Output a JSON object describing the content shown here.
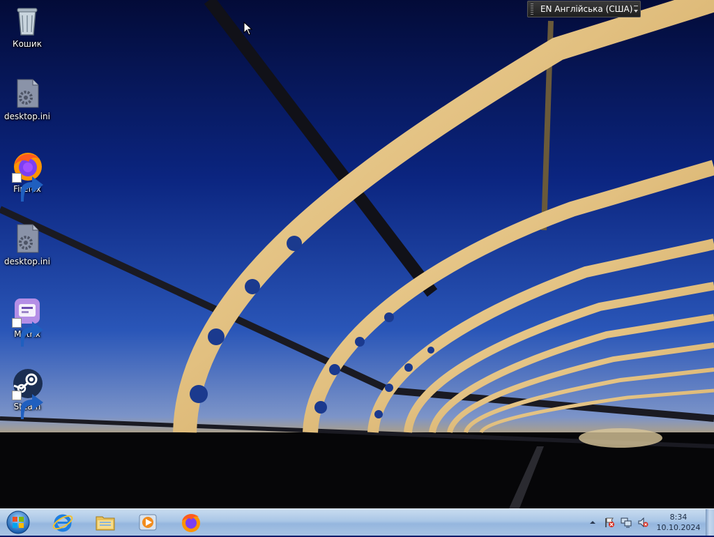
{
  "desktop": {
    "icons": [
      {
        "label": "Кошик",
        "icon": "recycle-bin-icon",
        "shortcut": false
      },
      {
        "label": "desktop.ini",
        "icon": "settings-file-icon",
        "shortcut": false
      },
      {
        "label": "Firefox",
        "icon": "firefox-icon",
        "shortcut": true
      },
      {
        "label": "desktop.ini",
        "icon": "settings-file-icon",
        "shortcut": false
      },
      {
        "label": "Motrix",
        "icon": "motrix-icon",
        "shortcut": true
      },
      {
        "label": "Steam",
        "icon": "steam-icon",
        "shortcut": true
      }
    ]
  },
  "language_bar": {
    "text": "EN Англійська (США)"
  },
  "taskbar": {
    "start_icon": "windows-start-icon",
    "pinned": [
      {
        "icon": "internet-explorer-icon"
      },
      {
        "icon": "file-explorer-icon"
      },
      {
        "icon": "media-player-icon"
      },
      {
        "icon": "firefox-icon"
      }
    ],
    "tray": {
      "icons": [
        "show-hidden-icons-arrow",
        "action-center-flag-icon",
        "network-icon",
        "volume-muted-icon"
      ]
    },
    "clock": {
      "time": "8:34",
      "date": "10.10.2024"
    }
  },
  "colors": {
    "sky_top": "#05104a",
    "sky_mid": "#173a9a",
    "horizon": "#6f8ac2",
    "arch_gold": "#e9c98a",
    "taskbar": "#a9c6e6"
  }
}
